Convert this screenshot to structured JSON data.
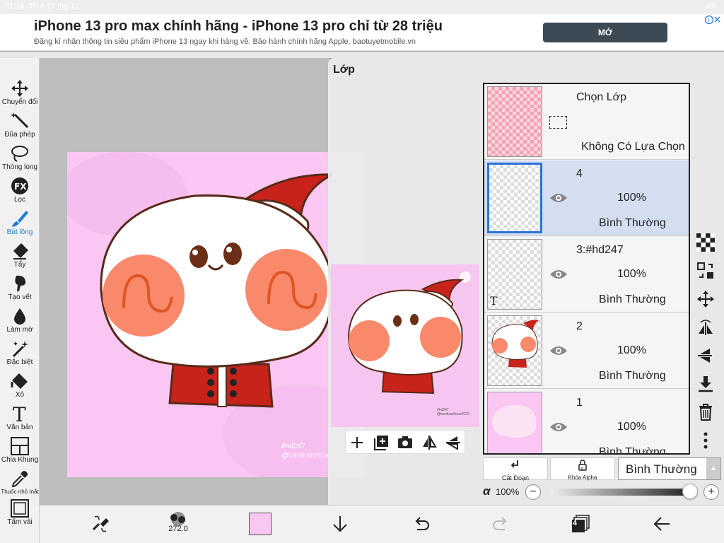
{
  "status": {
    "time": "11:16",
    "date": "Th 6 17 thg 12",
    "battery": "4%"
  },
  "ad": {
    "headline": "iPhone 13 pro max chính hãng - iPhone 13 pro chỉ từ 28 triệu",
    "subtext": "Đăng kí nhận thông tin siêu phẩm iPhone 13 ngay khi hàng về. Bảo hành chính hãng Apple. baotuyetmobile.vn",
    "button": "MỞ"
  },
  "tools": [
    {
      "label": "Chuyển đổi",
      "icon": "move-icon"
    },
    {
      "label": "Đũa phép",
      "icon": "magic-wand-icon"
    },
    {
      "label": "Thòng lọng",
      "icon": "lasso-icon"
    },
    {
      "label": "Lọc",
      "icon": "fx-icon"
    },
    {
      "label": "Bút lông",
      "icon": "brush-icon"
    },
    {
      "label": "Tẩy",
      "icon": "eraser-icon"
    },
    {
      "label": "Tạo vết",
      "icon": "smudge-icon"
    },
    {
      "label": "Làm mờ",
      "icon": "blur-icon"
    },
    {
      "label": "Đặc biệt",
      "icon": "special-icon"
    },
    {
      "label": "Xô",
      "icon": "bucket-icon"
    },
    {
      "label": "Văn bản",
      "icon": "text-icon"
    },
    {
      "label": "Chia Khung",
      "icon": "frame-divider-icon"
    },
    {
      "label": "Thuốc nhỏ mắt",
      "icon": "eyedropper-icon"
    },
    {
      "label": "Tấm vải",
      "icon": "canvas-icon"
    }
  ],
  "active_tool": "Bút lông",
  "artwork": {
    "watermark_line1": "#hd247",
    "watermark_line2": "@tranthanhtruc0070"
  },
  "preview": {
    "wm1": "#hd247",
    "wm2": "@tranthanhtruc0070"
  },
  "bottom": {
    "brush_size": "272.0",
    "layer_count": "4",
    "color": "#f9c7f2"
  },
  "panel": {
    "title": "Lớp",
    "selection_layer": {
      "name": "Chọn Lớp",
      "status": "Không Có Lựa Chọn"
    },
    "layers": [
      {
        "name": "4",
        "opacity": "100%",
        "mode": "Bình Thường",
        "selected": true
      },
      {
        "name": "3:#hd247",
        "opacity": "100%",
        "mode": "Bình Thường",
        "selected": false
      },
      {
        "name": "2",
        "opacity": "100%",
        "mode": "Bình Thường",
        "selected": false
      },
      {
        "name": "1",
        "opacity": "100%",
        "mode": "Bình Thường",
        "selected": false
      }
    ],
    "clip_label": "Cắt Đoạn",
    "alpha_lock_label": "Khóa Alpha",
    "blend_mode": "Bình Thường",
    "alpha_symbol": "α",
    "alpha_value": "100%"
  },
  "colors": {
    "accent": "#1e7ed6",
    "selected_layer": "#d3dff1",
    "canvas_bg": "#f9c7f2"
  }
}
